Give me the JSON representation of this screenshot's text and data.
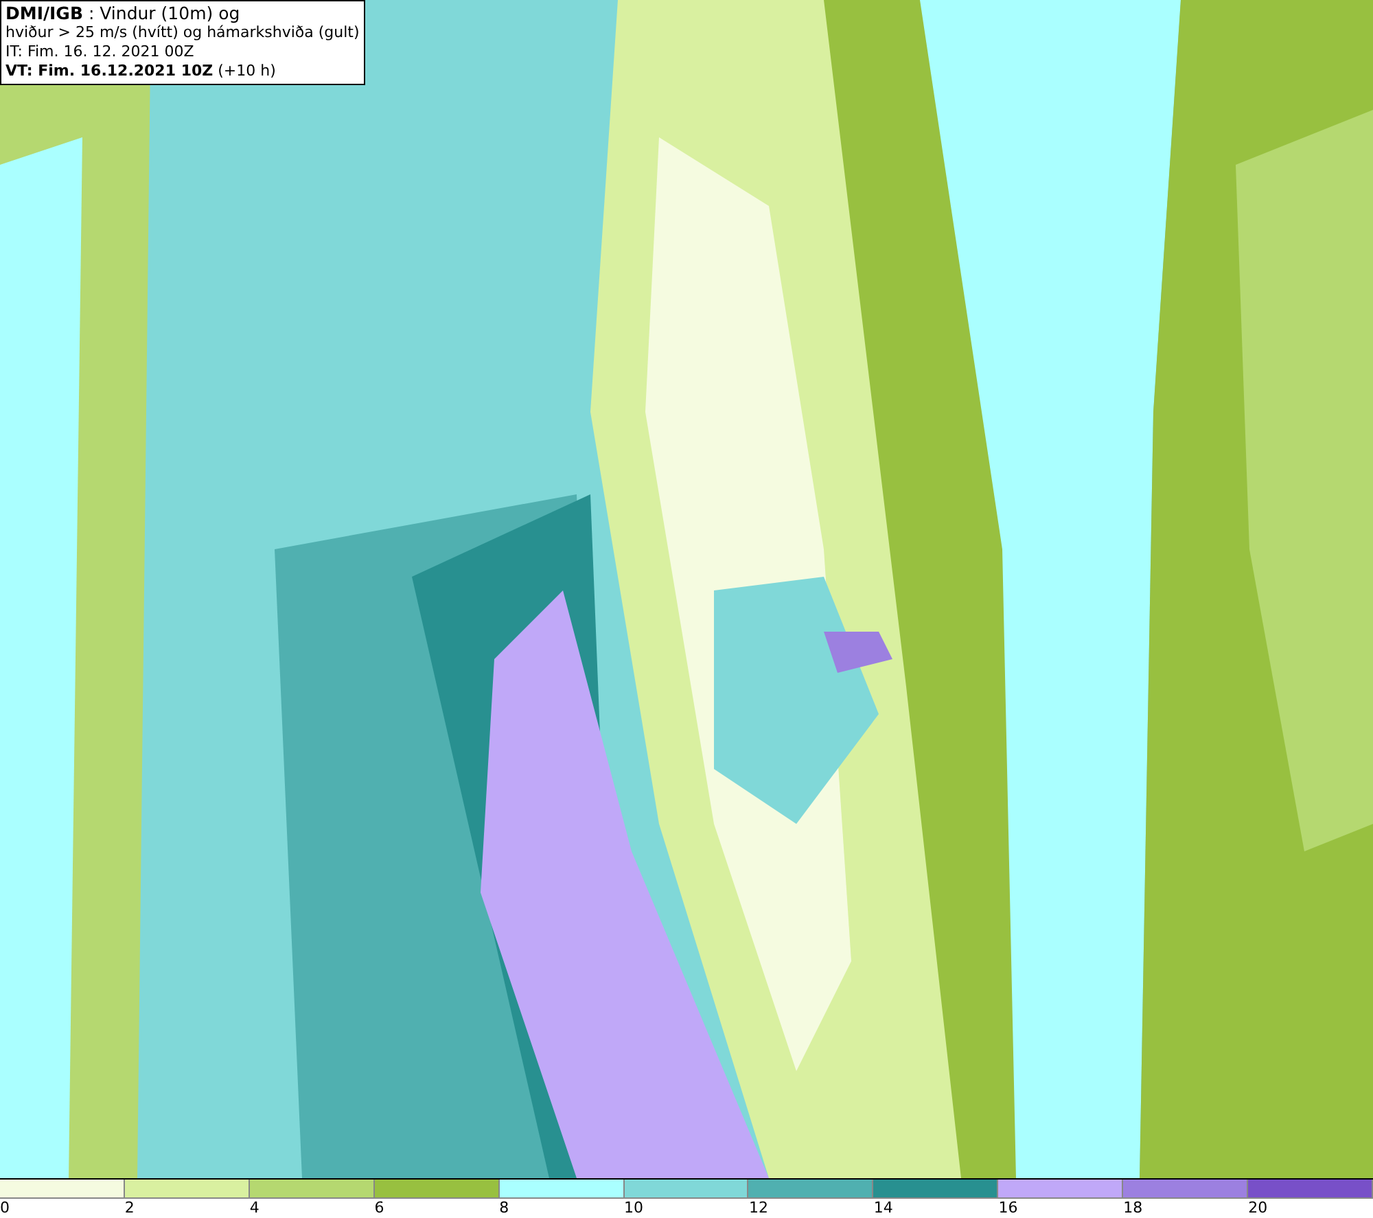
{
  "title_box": {
    "lines": [
      "**DMI/IGB** : Vindur (10m) og",
      "hviður > 25 m/s (hvítt) og hámarkshviða (gult)",
      "IT: Fim. 16. 12. 2021 00Z",
      "**VT: Fim. 16.12.2021 10Z** (+10 h)"
    ]
  },
  "legend": {
    "bins": [
      {
        "label": "0",
        "color": "#f5fbe0"
      },
      {
        "label": "2",
        "color": "#d9f0a0"
      },
      {
        "label": "4",
        "color": "#b5d870"
      },
      {
        "label": "6",
        "color": "#98c040"
      },
      {
        "label": "8",
        "color": "#aaffff"
      },
      {
        "label": "10",
        "color": "#80d8d8"
      },
      {
        "label": "12",
        "color": "#50b0b0"
      },
      {
        "label": "14",
        "color": "#289090"
      },
      {
        "label": "16",
        "color": "#c0a8f8"
      },
      {
        "label": "18",
        "color": "#9c80e0"
      },
      {
        "label": "20",
        "color": "#7850c8"
      }
    ]
  }
}
